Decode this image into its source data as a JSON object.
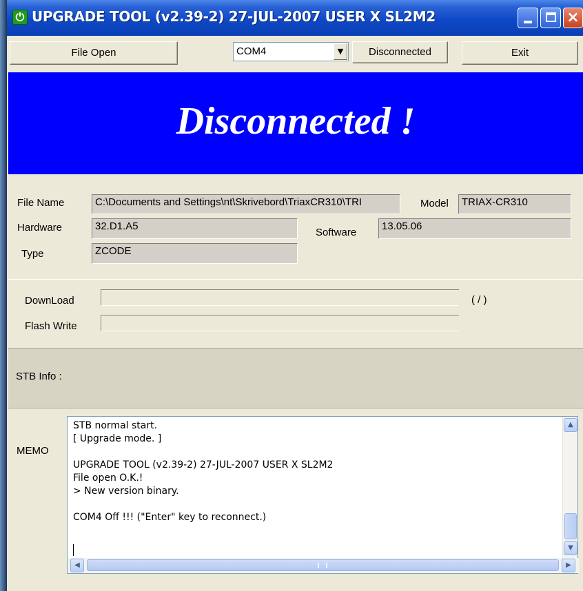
{
  "window": {
    "title": "UPGRADE TOOL (v2.39-2) 27-JUL-2007 USER X SL2M2",
    "icon": "power-icon",
    "title_bar_color": "#0a3fb4",
    "controls": [
      "minimize-icon",
      "maximize-icon",
      "close-icon"
    ],
    "close_glyph": "×"
  },
  "toolbar": {
    "file_open_label": "File Open",
    "com_port_value": "COM4",
    "connect_label": "Disconnected",
    "exit_label": "Exit"
  },
  "status": {
    "text": "Disconnected !",
    "background": "#0000ff",
    "text_color": "#ffffff"
  },
  "info": {
    "file_name_label": "File Name",
    "file_name_value": "C:\\Documents and Settings\\nt\\Skrivebord\\TriaxCR310\\TRI",
    "model_label": "Model",
    "model_value": "TRIAX-CR310",
    "hardware_label": "Hardware",
    "hardware_value": "32.D1.A5",
    "software_label": "Software",
    "software_value": "13.05.06",
    "type_label": "Type",
    "type_value": "ZCODE"
  },
  "progress": {
    "download_label": "DownLoad",
    "download_count": "( / )",
    "flash_label": "Flash Write"
  },
  "stb_info_label": "STB Info :",
  "memo": {
    "label": "MEMO",
    "text": "STB normal start.\n[ Upgrade mode. ]\n\nUPGRADE TOOL (v2.39-2) 27-JUL-2007 USER X SL2M2\nFile open O.K.!\n> New version binary.\n\nCOM4 Off !!! (\"Enter\" key to reconnect.)"
  }
}
